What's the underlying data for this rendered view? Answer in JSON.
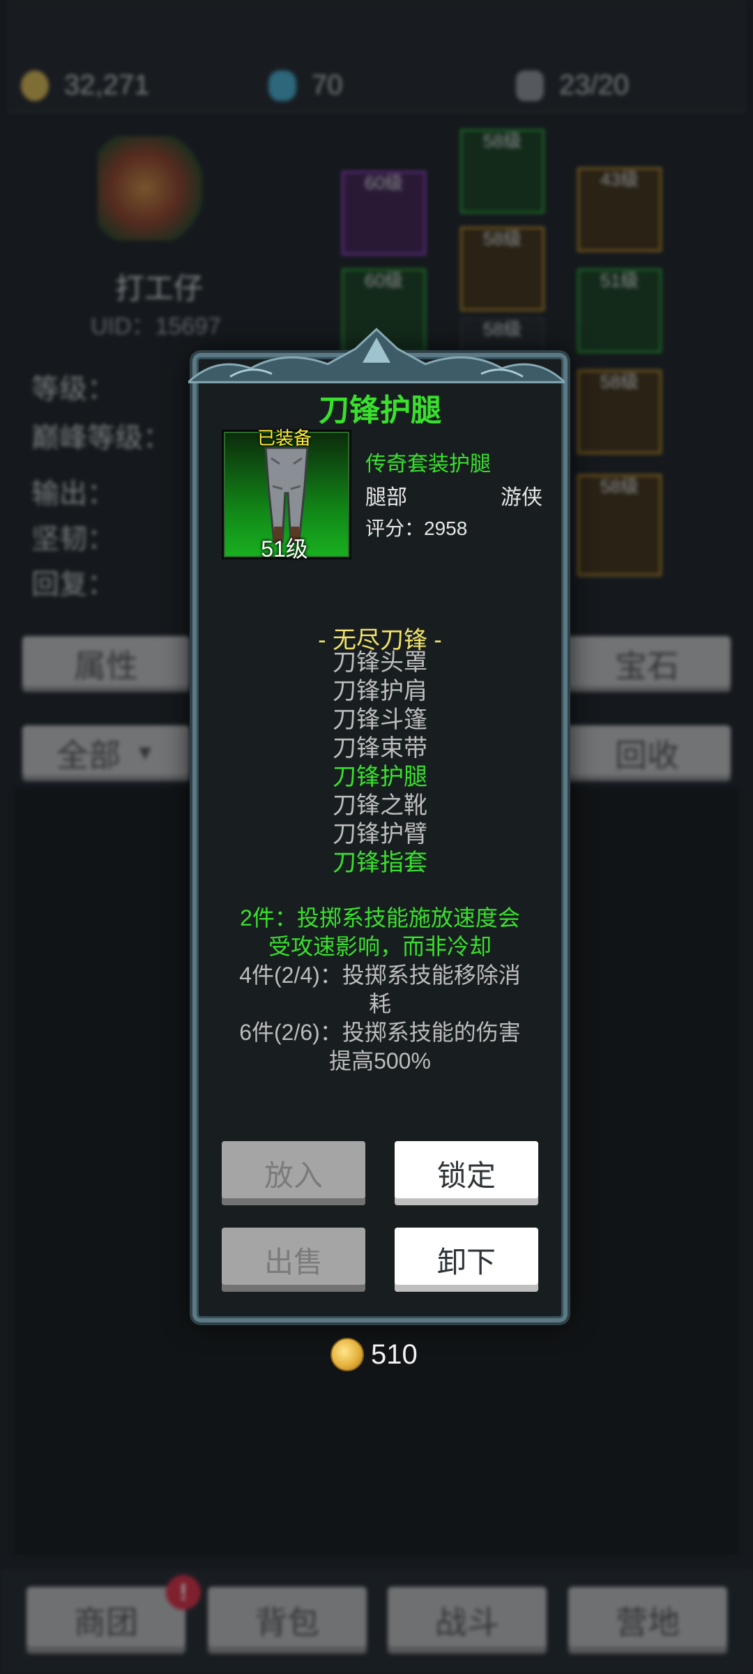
{
  "background": {
    "currency": [
      {
        "icon": "gold-coin-icon",
        "value": "32,271"
      },
      {
        "icon": "blue-gem-icon",
        "value": "70"
      },
      {
        "icon": "bag-capacity-icon",
        "value": "23/20"
      }
    ],
    "character": {
      "name": "打工仔",
      "uid": "UID：15697"
    },
    "stats": [
      "等级：",
      "巅峰等级：",
      "输出：",
      "坚韧：",
      "回复："
    ],
    "slots": [
      {
        "level": "60级"
      },
      {
        "level": "58级"
      },
      {
        "level": "43级"
      },
      {
        "level": "60级"
      },
      {
        "level": "58级"
      },
      {
        "level": "51级"
      },
      {
        "level": "58级"
      },
      {
        "level": "58级"
      },
      {
        "level": "58级"
      }
    ],
    "buttons": {
      "attributes": "属性",
      "gems": "宝石",
      "all": "全部",
      "recycle": "回收"
    },
    "nav": {
      "guild": "商团",
      "backpack": "背包",
      "battle": "战斗",
      "camp": "营地",
      "badge": "!"
    }
  },
  "dialog": {
    "title": "刀锋护腿",
    "item": {
      "equipped_label": "已装备",
      "level": "51级",
      "set_type": "传奇套装护腿",
      "slot": "腿部",
      "class": "游侠",
      "score": "评分：2958"
    },
    "set": {
      "name": "- 无尽刀锋 -",
      "pieces": [
        {
          "name": "刀锋头罩",
          "owned": false
        },
        {
          "name": "刀锋护肩",
          "owned": false
        },
        {
          "name": "刀锋斗篷",
          "owned": false
        },
        {
          "name": "刀锋束带",
          "owned": false
        },
        {
          "name": "刀锋护腿",
          "owned": true
        },
        {
          "name": "刀锋之靴",
          "owned": false
        },
        {
          "name": "刀锋护臂",
          "owned": false
        },
        {
          "name": "刀锋指套",
          "owned": true
        }
      ],
      "bonuses": [
        {
          "lines": [
            "2件：投掷系技能施放速度会",
            "受攻速影响，而非冷却"
          ],
          "active": true
        },
        {
          "lines": [
            "4件(2/4)：投掷系技能移除消",
            "耗"
          ],
          "active": false
        },
        {
          "lines": [
            "6件(2/6)：投掷系技能的伤害",
            "提高500%"
          ],
          "active": false
        }
      ]
    },
    "buttons": {
      "put_in": "放入",
      "lock": "锁定",
      "sell": "出售",
      "unequip": "卸下"
    },
    "price": "510"
  },
  "colors": {
    "set_green": "#39e02c",
    "set_title_yellow": "#f1e26a",
    "equipped_yellow": "#ffeb3b"
  }
}
